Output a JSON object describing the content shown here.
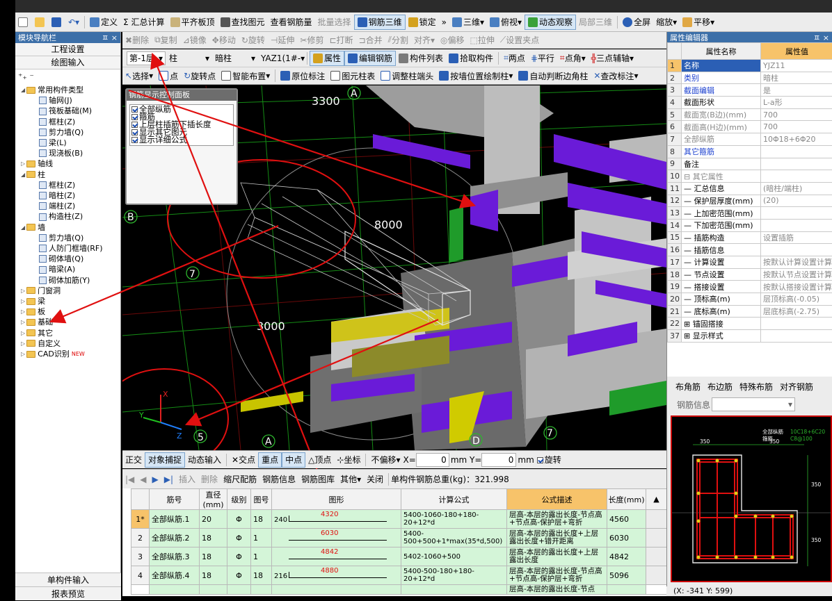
{
  "titlebar": {
    "items": [
      "",
      "",
      ""
    ]
  },
  "topbar": {
    "items": [
      "定义",
      "Σ 汇总计算",
      "平齐板顶",
      "查找图元",
      "查看钢筋量",
      "批量选择",
      "钢筋三维",
      "锁定",
      "三维",
      "俯视",
      "动态观察",
      "局部三维",
      "全屏",
      "缩放",
      "平移"
    ],
    "more": "»"
  },
  "nav": {
    "title": "模块导航栏",
    "pin": "ㅍ ×",
    "btn1": "工程设置",
    "btn2": "绘图输入",
    "tree": [
      {
        "label": "常用构件类型",
        "level": 0,
        "type": "folder"
      },
      {
        "label": "轴网(J)",
        "level": 1,
        "type": "comp"
      },
      {
        "label": "筏板基础(M)",
        "level": 1,
        "type": "comp"
      },
      {
        "label": "框柱(Z)",
        "level": 1,
        "type": "comp"
      },
      {
        "label": "剪力墙(Q)",
        "level": 1,
        "type": "comp"
      },
      {
        "label": "梁(L)",
        "level": 1,
        "type": "comp"
      },
      {
        "label": "现浇板(B)",
        "level": 1,
        "type": "comp"
      },
      {
        "label": "轴线",
        "level": 0,
        "type": "folder"
      },
      {
        "label": "柱",
        "level": 0,
        "type": "folder"
      },
      {
        "label": "框柱(Z)",
        "level": 1,
        "type": "comp"
      },
      {
        "label": "暗柱(Z)",
        "level": 1,
        "type": "comp"
      },
      {
        "label": "端柱(Z)",
        "level": 1,
        "type": "comp"
      },
      {
        "label": "构造柱(Z)",
        "level": 1,
        "type": "comp"
      },
      {
        "label": "墙",
        "level": 0,
        "type": "folder"
      },
      {
        "label": "剪力墙(Q)",
        "level": 1,
        "type": "comp"
      },
      {
        "label": "人防门框墙(RF)",
        "level": 1,
        "type": "comp"
      },
      {
        "label": "砌体墙(Q)",
        "level": 1,
        "type": "comp"
      },
      {
        "label": "暗梁(A)",
        "level": 1,
        "type": "comp"
      },
      {
        "label": "砌体加筋(Y)",
        "level": 1,
        "type": "comp"
      },
      {
        "label": "门窗洞",
        "level": 0,
        "type": "folder"
      },
      {
        "label": "梁",
        "level": 0,
        "type": "folder"
      },
      {
        "label": "板",
        "level": 0,
        "type": "folder"
      },
      {
        "label": "基础",
        "level": 0,
        "type": "folder"
      },
      {
        "label": "其它",
        "level": 0,
        "type": "folder"
      },
      {
        "label": "自定义",
        "level": 0,
        "type": "folder"
      },
      {
        "label": "CAD识别",
        "level": 0,
        "type": "folder"
      }
    ],
    "new_badge": "NEW",
    "bottom1": "单构件输入",
    "bottom2": "报表预览"
  },
  "toolbar2": {
    "items": [
      "删除",
      "复制",
      "镜像",
      "移动",
      "旋转",
      "延伸",
      "修剪",
      "打断",
      "合并",
      "分割",
      "对齐",
      "偏移",
      "拉伸",
      "设置夹点"
    ]
  },
  "toolbar3": {
    "floor": "第-1层",
    "category": "柱",
    "type": "暗柱",
    "component": "YAZ1(1#-",
    "items": [
      "属性",
      "编辑钢筋",
      "构件列表",
      "拾取构件",
      "两点",
      "平行",
      "点角",
      "三点辅轴"
    ]
  },
  "toolbar4": {
    "items": [
      "选择",
      "点",
      "旋转点",
      "智能布置",
      "原位标注",
      "图元柱表",
      "调整柱端头",
      "按墙位置绘制柱",
      "自动判断边角柱",
      "查改标注"
    ]
  },
  "rebar_panel": {
    "title": "钢筋显示控制面板",
    "options": [
      "全部纵筋",
      "箍筋",
      "上层柱插筋下插长度",
      "显示其它图元",
      "显示详细公式"
    ]
  },
  "viewport": {
    "labels": [
      "A",
      "3300",
      "B",
      "8000",
      "7",
      "3000",
      "A",
      "D",
      "7",
      "5"
    ],
    "axis": [
      "Y",
      "X",
      "Z"
    ]
  },
  "snapbar": {
    "items": [
      "正交",
      "对象捕捉",
      "动态输入",
      "交点",
      "重点",
      "中点",
      "顶点",
      "坐标",
      "不偏移",
      "X=",
      "0",
      "mm Y=",
      "0",
      "mm",
      "旋转"
    ]
  },
  "tablebar": {
    "items": [
      "插入",
      "删除",
      "缩尺配筋",
      "钢筋信息",
      "钢筋图库",
      "其他",
      "关闭"
    ],
    "total": "单构件钢筋总重(kg)：321.998"
  },
  "rebar_table": {
    "columns": [
      "",
      "筋号",
      "直径(mm)",
      "级别",
      "图号",
      "图形",
      "计算公式",
      "公式描述",
      "长度(mm)"
    ],
    "rows": [
      {
        "no": "1*",
        "name": "全部纵筋.1",
        "dia": "20",
        "grade": "Φ",
        "fig": "18",
        "lead": "240",
        "shape": "4320",
        "formula": "5400-1060-180+180-20+12*d",
        "desc": "层高-本层的露出长度-节点高+节点高-保护层+弯折",
        "len": "4560"
      },
      {
        "no": "2",
        "name": "全部纵筋.2",
        "dia": "18",
        "grade": "Φ",
        "fig": "1",
        "lead": "",
        "shape": "6030",
        "formula": "5400-500+500+1*max(35*d,500)",
        "desc": "层高-本层的露出长度+上层露出长度+错开距离",
        "len": "6030"
      },
      {
        "no": "3",
        "name": "全部纵筋.3",
        "dia": "18",
        "grade": "Φ",
        "fig": "1",
        "lead": "",
        "shape": "4842",
        "formula": "5402-1060+500",
        "desc": "层高-本层的露出长度+上层露出长度",
        "len": "4842"
      },
      {
        "no": "4",
        "name": "全部纵筋.4",
        "dia": "18",
        "grade": "Φ",
        "fig": "18",
        "lead": "216",
        "shape": "4880",
        "formula": "5400-500-180+180-20+12*d",
        "desc": "层高-本层的露出长度-节点高+节点高-保护层+弯折",
        "len": "5096"
      }
    ],
    "partial": "层高-本层的露出长度-节点"
  },
  "props": {
    "title": "属性编辑器",
    "pin": "ㅍ ×",
    "col_name": "属性名称",
    "col_value": "属性值",
    "rows": [
      {
        "no": "1",
        "name": "名称",
        "value": "YJZ11",
        "style": "blue",
        "sel": true
      },
      {
        "no": "2",
        "name": "类别",
        "value": "暗柱",
        "style": "blue"
      },
      {
        "no": "3",
        "name": "截面编辑",
        "value": "是",
        "style": "blue"
      },
      {
        "no": "4",
        "name": "截面形状",
        "value": "L-a形",
        "style": ""
      },
      {
        "no": "5",
        "name": "截面宽(B边)(mm)",
        "value": "700",
        "style": "gray"
      },
      {
        "no": "6",
        "name": "截面高(H边)(mm)",
        "value": "700",
        "style": "gray"
      },
      {
        "no": "7",
        "name": "全部纵筋",
        "value": "10Φ18+6Φ20",
        "style": "gray"
      },
      {
        "no": "8",
        "name": "其它箍筋",
        "value": "",
        "style": "blue"
      },
      {
        "no": "9",
        "name": "备注",
        "value": "",
        "style": ""
      },
      {
        "no": "10",
        "name": "⊟ 其它属性",
        "value": "",
        "style": "gray"
      },
      {
        "no": "11",
        "name": "— 汇总信息",
        "value": "(暗柱/端柱)",
        "style": ""
      },
      {
        "no": "12",
        "name": "— 保护层厚度(mm)",
        "value": "(20)",
        "style": ""
      },
      {
        "no": "13",
        "name": "— 上加密范围(mm)",
        "value": "",
        "style": ""
      },
      {
        "no": "14",
        "name": "— 下加密范围(mm)",
        "value": "",
        "style": ""
      },
      {
        "no": "15",
        "name": "— 插筋构造",
        "value": "设置插筋",
        "style": ""
      },
      {
        "no": "16",
        "name": "— 插筋信息",
        "value": "",
        "style": ""
      },
      {
        "no": "17",
        "name": "— 计算设置",
        "value": "按默认计算设置计算",
        "style": ""
      },
      {
        "no": "18",
        "name": "— 节点设置",
        "value": "按默认节点设置计算",
        "style": ""
      },
      {
        "no": "19",
        "name": "— 搭接设置",
        "value": "按默认搭接设置计算",
        "style": ""
      },
      {
        "no": "20",
        "name": "— 顶标高(m)",
        "value": "层顶标高(-0.05)",
        "style": ""
      },
      {
        "no": "21",
        "name": "— 底标高(m)",
        "value": "层底标高(-2.75)",
        "style": ""
      },
      {
        "no": "22",
        "name": "⊞ 锚固搭接",
        "value": "",
        "style": ""
      },
      {
        "no": "37",
        "name": "⊞ 显示样式",
        "value": "",
        "style": ""
      }
    ]
  },
  "section": {
    "tabs": [
      "布角筋",
      "布边筋",
      "特殊布筋",
      "对齐钢筋"
    ],
    "info_label": "钢筋信息",
    "labels": [
      "全部纵筋",
      "箍筋",
      "10C18+6C20",
      "C8@100",
      "350",
      "350",
      "350",
      "350"
    ]
  },
  "coords": "(X: -341 Y: 599)",
  "colors": {
    "accent": "#3c6fa8",
    "annotation": "#e01010",
    "beam_purple": "#6a1bd8",
    "grid_green": "#2db42d"
  }
}
